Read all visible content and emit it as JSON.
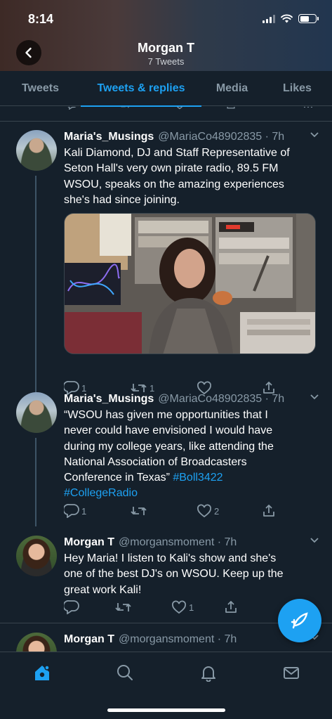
{
  "status_bar": {
    "time": "8:14"
  },
  "header": {
    "title": "Morgan T",
    "subtitle": "7 Tweets"
  },
  "tabs": [
    {
      "label": "Tweets",
      "active": false
    },
    {
      "label": "Tweets & replies",
      "active": true
    },
    {
      "label": "Media",
      "active": false
    },
    {
      "label": "Likes",
      "active": false
    }
  ],
  "tweets": [
    {
      "name": "Maria's_Musings",
      "handle": "@MariaCo48902835 · 7h",
      "lines": [
        "Kali Diamond, DJ and Staff Representative of",
        "Seton Hall's very own pirate radio, 89.5 FM",
        "WSOU, speaks on the amazing experiences",
        "she's had since joining."
      ],
      "reply_count": "1",
      "retweet_count": "1",
      "like_count": ""
    },
    {
      "name": "Maria's_Musings",
      "handle": "@MariaCo48902835 · 7h",
      "lines": [
        "“WSOU has given me opportunities that I",
        "never could have envisioned I would have",
        "during my college years, like attending the",
        "National Association of Broadcasters",
        "Conference in Texas” "
      ],
      "hashtag1": "#Boll3422",
      "hashtag2": "#CollegeRadio",
      "reply_count": "1",
      "retweet_count": "",
      "like_count": "2"
    },
    {
      "name": "Morgan T",
      "handle": "@morgansmoment · 7h",
      "lines": [
        "Hey Maria! I listen to Kali's show and she's",
        "one of the best DJ's on WSOU. Keep up the",
        "great work Kali!"
      ],
      "reply_count": "",
      "retweet_count": "",
      "like_count": "1"
    },
    {
      "name": "Morgan T",
      "handle": "@morgansmoment · 7h"
    }
  ],
  "colors": {
    "accent": "#1da1f2",
    "background": "#15202b",
    "secondary_text": "#8899a6",
    "divider": "#38444d"
  },
  "icons": [
    "back-arrow-icon",
    "reply-icon",
    "retweet-icon",
    "like-icon",
    "share-icon",
    "chevron-down-icon",
    "compose-icon",
    "home-icon",
    "search-icon",
    "notifications-icon",
    "messages-icon"
  ]
}
